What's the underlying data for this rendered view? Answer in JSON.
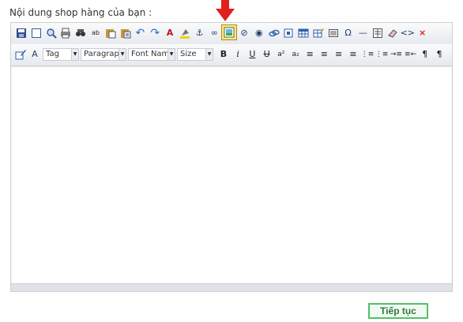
{
  "page": {
    "title": "Nội dung shop hàng của bạn :"
  },
  "toolbar": {
    "row1": [
      {
        "name": "save-icon",
        "glyph": ""
      },
      {
        "name": "new-page-icon",
        "glyph": ""
      },
      {
        "name": "preview-icon",
        "glyph": ""
      },
      {
        "name": "print-icon",
        "glyph": ""
      },
      {
        "name": "find-icon",
        "glyph": ""
      },
      {
        "name": "spellcheck-icon",
        "glyph": "ab"
      },
      {
        "name": "paste-icon",
        "glyph": ""
      },
      {
        "name": "paste-text-icon",
        "glyph": ""
      },
      {
        "name": "undo-icon",
        "glyph": "↶"
      },
      {
        "name": "redo-icon",
        "glyph": "↷"
      },
      {
        "name": "text-color-icon",
        "glyph": "A"
      },
      {
        "name": "background-color-icon",
        "glyph": ""
      },
      {
        "name": "anchor-icon",
        "glyph": "⚓"
      },
      {
        "name": "link-icon",
        "glyph": "∞"
      },
      {
        "name": "insert-image-icon",
        "glyph": ""
      },
      {
        "name": "flash-icon",
        "glyph": "⊘"
      },
      {
        "name": "media-icon",
        "glyph": "◉"
      },
      {
        "name": "document-link-icon",
        "glyph": ""
      },
      {
        "name": "frame-icon",
        "glyph": ""
      },
      {
        "name": "table-icon",
        "glyph": ""
      },
      {
        "name": "table-edit-icon",
        "glyph": ""
      },
      {
        "name": "insert-box-icon",
        "glyph": ""
      },
      {
        "name": "special-char-icon",
        "glyph": "Ω"
      },
      {
        "name": "horizontal-rule-icon",
        "glyph": "—"
      },
      {
        "name": "form-icon",
        "glyph": ""
      },
      {
        "name": "eraser-icon",
        "glyph": ""
      },
      {
        "name": "source-code-icon",
        "glyph": "<>"
      },
      {
        "name": "close-icon",
        "glyph": "×"
      }
    ],
    "row2_left": [
      {
        "name": "style-icon",
        "glyph": ""
      },
      {
        "name": "font-style-icon",
        "glyph": "A"
      }
    ],
    "selects": {
      "tag": "Tag",
      "paragraph": "Paragraph",
      "font_name": "Font Name",
      "size": "Size"
    },
    "row2_right": [
      {
        "name": "bold-icon",
        "glyph": "B"
      },
      {
        "name": "italic-icon",
        "glyph": "i"
      },
      {
        "name": "underline-icon",
        "glyph": "U"
      },
      {
        "name": "strikethrough-icon",
        "glyph": "U"
      },
      {
        "name": "superscript-icon",
        "glyph": "a²"
      },
      {
        "name": "subscript-icon",
        "glyph": "a₂"
      },
      {
        "name": "align-left-icon",
        "glyph": "≡"
      },
      {
        "name": "align-center-icon",
        "glyph": "≡"
      },
      {
        "name": "align-right-icon",
        "glyph": "≡"
      },
      {
        "name": "align-justify-icon",
        "glyph": "≡"
      },
      {
        "name": "ordered-list-icon",
        "glyph": "⋮≡"
      },
      {
        "name": "unordered-list-icon",
        "glyph": "⋮≡"
      },
      {
        "name": "indent-icon",
        "glyph": "→≡"
      },
      {
        "name": "outdent-icon",
        "glyph": "≡←"
      },
      {
        "name": "ltr-icon",
        "glyph": "¶"
      },
      {
        "name": "rtl-icon",
        "glyph": "¶"
      }
    ]
  },
  "actions": {
    "next_label": "Tiếp tục"
  },
  "colors": {
    "highlight_border": "#b8870a",
    "highlight_fill": "#ffe48e",
    "arrow": "#e0201d",
    "next_border": "#53c06b"
  }
}
